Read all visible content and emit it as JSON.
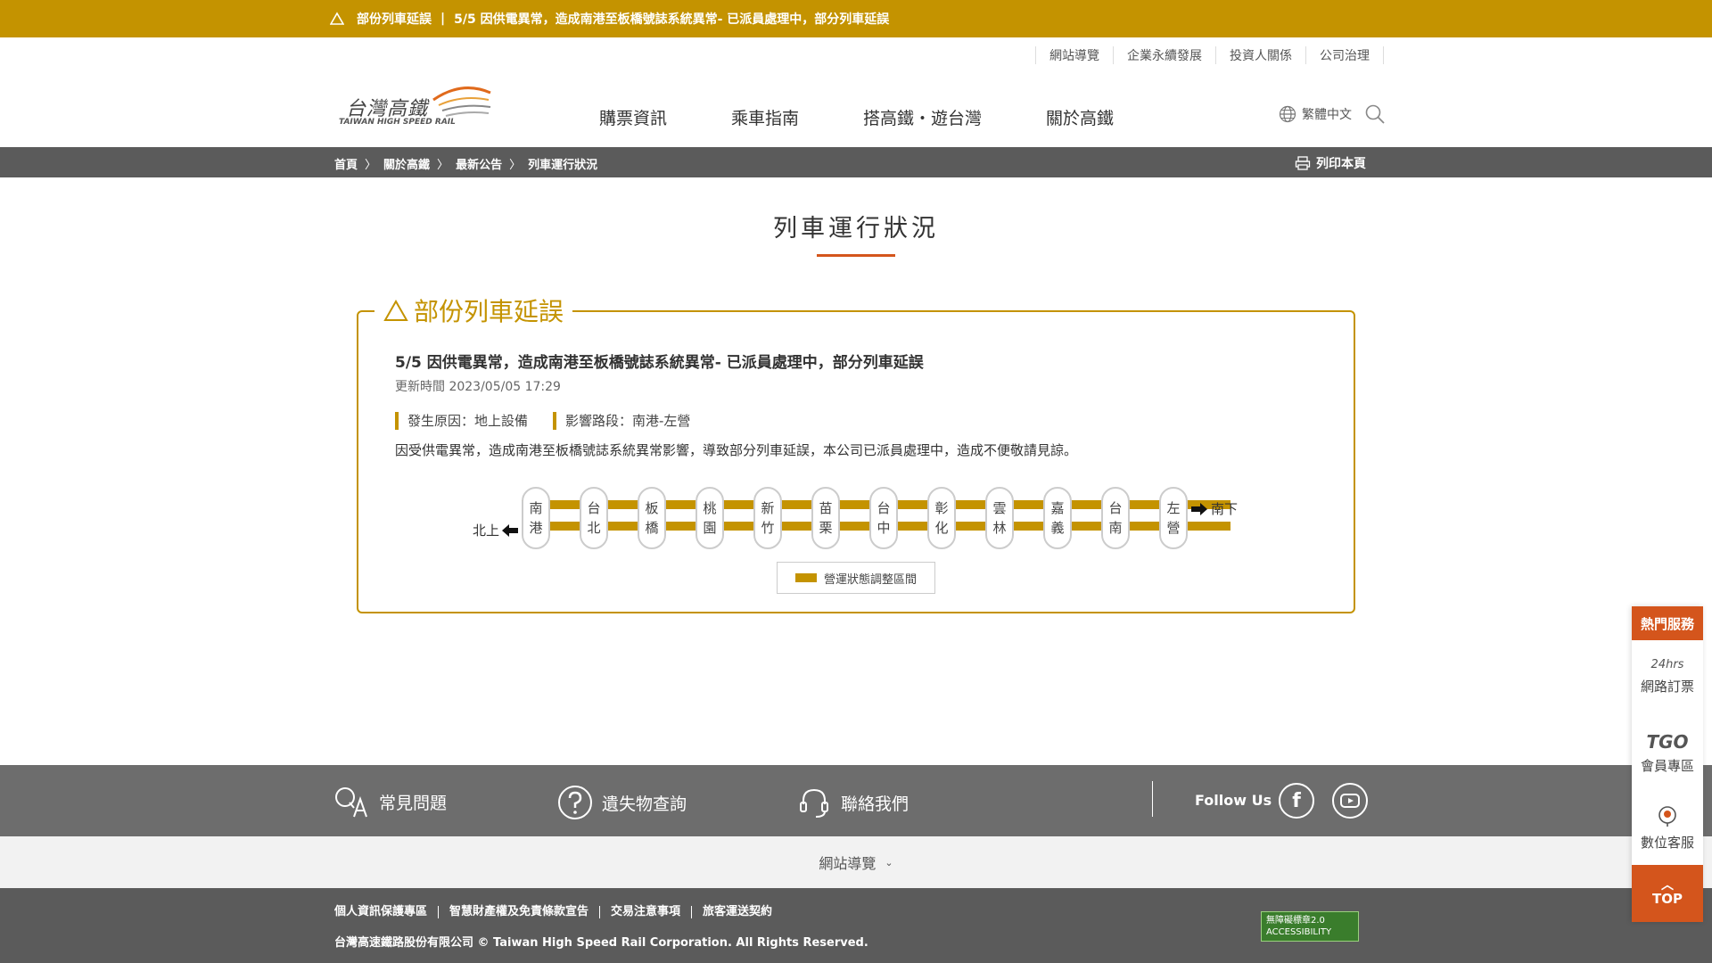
{
  "alert": {
    "label": "部份列車延誤",
    "separator": "|",
    "message": "5/5 因供電異常，造成南港至板橋號誌系統異常- 已派員處理中，部分列車延誤"
  },
  "top_links": [
    "網站導覽",
    "企業永續發展",
    "投資人關係",
    "公司治理"
  ],
  "logo": {
    "zh": "台灣高鐵",
    "en": "TAIWAN HIGH SPEED RAIL"
  },
  "main_nav": [
    "購票資訊",
    "乘車指南",
    "搭高鐵・遊台灣",
    "關於高鐵"
  ],
  "language": "繁體中文",
  "breadcrumb": [
    "首頁",
    "關於高鐵",
    "最新公告",
    "列車運行狀況"
  ],
  "breadcrumb_arrow": "〉",
  "print_label": "列印本頁",
  "page_title": "列車運行狀況",
  "notice": {
    "heading": "部份列車延誤",
    "title": "5/5 因供電異常，造成南港至板橋號誌系統異常- 已派員處理中，部分列車延誤",
    "update_time": "更新時間 2023/05/05 17:29",
    "cause": "發生原因：地上設備",
    "section": "影響路段：南港-左營",
    "description": "因受供電異常，造成南港至板橋號誌系統異常影響，導致部分列車延誤，本公司已派員處理中，造成不便敬請見諒。"
  },
  "line": {
    "north_label": "北上",
    "south_label": "南下",
    "stations": [
      {
        "c1": "南",
        "c2": "港"
      },
      {
        "c1": "台",
        "c2": "北"
      },
      {
        "c1": "板",
        "c2": "橋"
      },
      {
        "c1": "桃",
        "c2": "園"
      },
      {
        "c1": "新",
        "c2": "竹"
      },
      {
        "c1": "苗",
        "c2": "栗"
      },
      {
        "c1": "台",
        "c2": "中"
      },
      {
        "c1": "彰",
        "c2": "化"
      },
      {
        "c1": "雲",
        "c2": "林"
      },
      {
        "c1": "嘉",
        "c2": "義"
      },
      {
        "c1": "台",
        "c2": "南"
      },
      {
        "c1": "左",
        "c2": "營"
      }
    ],
    "legend": "營運狀態調整區間",
    "track_color": "#c49300"
  },
  "footer": {
    "faq": "常見問題",
    "lost_found": "遺失物查詢",
    "contact": "聯絡我們",
    "follow": "Follow Us",
    "facebook_glyph": "f",
    "sitemap": "網站導覽",
    "sitemap_chevron": "⌄",
    "legal": [
      "個人資訊保護專區",
      "智慧財產權及免責條款宣告",
      "交易注意事項",
      "旅客運送契約"
    ],
    "copyright": "台灣高速鐵路股份有限公司 © Taiwan High Speed Rail Corporation. All Rights Reserved.",
    "accessibility": "無障礙標章2.0",
    "accessibility_en": "ACCESSIBILITY"
  },
  "side_panel": {
    "heading": "熱門服務",
    "items": [
      {
        "icon_text": "24hrs",
        "label": "網路訂票"
      },
      {
        "icon_text": "TGO",
        "label": "會員專區"
      },
      {
        "icon_text": "",
        "label": "數位客服"
      }
    ],
    "top_label": "TOP",
    "top_arrow": "︿"
  },
  "colors": {
    "accent_gold": "#c49300",
    "accent_orange": "#d4551c",
    "dark_gray": "#5b5b5b"
  }
}
